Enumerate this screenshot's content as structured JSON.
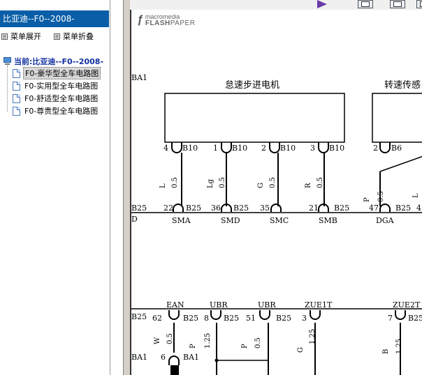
{
  "left_panel": {
    "title": "比亚迪--F0--2008-",
    "expand_menu": "菜单展开",
    "collapse_menu": "菜单折叠",
    "tree_root": "当前:比亚迪--F0--2008-",
    "tree_items": [
      {
        "label": "F0-豪华型全车电路图",
        "selected": true
      },
      {
        "label": "F0-实用型全车电路图",
        "selected": false
      },
      {
        "label": "F0-舒适型全车电路图",
        "selected": false
      },
      {
        "label": "F0-尊贵型全车电路图",
        "selected": false
      }
    ]
  },
  "viewer": {
    "logo_macromedia": "macromedia",
    "logo_flash": "FLASH",
    "logo_paper": "PAPER",
    "play_color": "#6a3aa8"
  },
  "schematic": {
    "connector_ba1": "BA1",
    "motor_title": "怠速步进电机",
    "sensor_title": "转速传感",
    "motor_pins": [
      {
        "pin": "4",
        "conn": "B10",
        "wire_color": "L",
        "wire_size": "0.5",
        "signal": "SMA",
        "bottom_pin": "22",
        "bottom_conn": "B25"
      },
      {
        "pin": "1",
        "conn": "B10",
        "wire_color": "Lg",
        "wire_size": "0.5",
        "signal": "SMD",
        "bottom_pin": "36",
        "bottom_conn": "B25"
      },
      {
        "pin": "2",
        "conn": "B10",
        "wire_color": "G",
        "wire_size": "0.5",
        "signal": "SMC",
        "bottom_pin": "35",
        "bottom_conn": ""
      },
      {
        "pin": "3",
        "conn": "B10",
        "wire_color": "R",
        "wire_size": "0.5",
        "signal": "SMB",
        "bottom_pin": "21",
        "bottom_conn": "B25"
      }
    ],
    "sensor_pin": {
      "pin": "2",
      "conn": "B6",
      "wire_color": "P",
      "wire_size": "0.5",
      "signal": "DGA",
      "bottom_pin": "47",
      "bottom_conn": "B25",
      "extra_pin": "4",
      "extra_color": "L"
    },
    "row1_left_conn": "B25",
    "row1_left_char": "D",
    "lower_signals": [
      {
        "name": "EAN",
        "pin": "62",
        "conn": "B25"
      },
      {
        "name": "UBR",
        "pin": "8",
        "conn": "B25"
      },
      {
        "name": "UBR",
        "pin": "51",
        "conn": "B25"
      },
      {
        "name": "ZUE1T",
        "pin": "3",
        "conn": "B25"
      },
      {
        "name": "ZUE2T",
        "pin": "7",
        "conn": "B25"
      }
    ],
    "lower_left_conn": "B25",
    "lower_wires": [
      {
        "color": "W",
        "size": "0.5"
      },
      {
        "color": "P",
        "size": "1.25"
      },
      {
        "color": "P",
        "size": "0.5"
      },
      {
        "color": "G",
        "size": "1.25"
      },
      {
        "color": "B",
        "size": "1.25"
      }
    ],
    "bottom_conn_left": "BA1",
    "bottom_pin": "6",
    "bottom_conn_right": "BA1"
  }
}
